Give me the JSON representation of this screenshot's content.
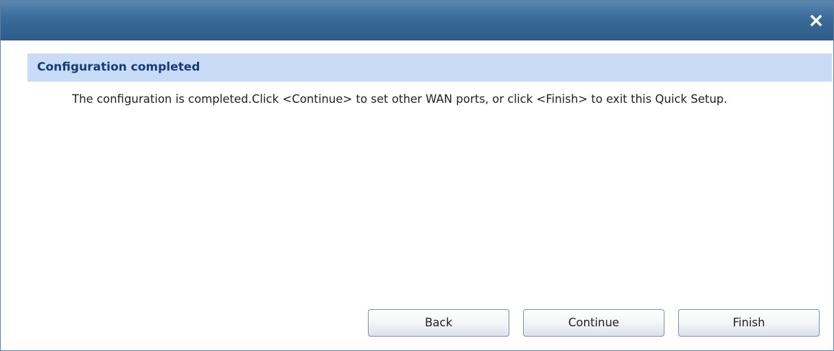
{
  "dialog": {
    "close_icon": "close-icon",
    "section_title": "Configuration completed",
    "message": "The configuration is completed.Click <Continue> to set other WAN ports, or click <Finish> to exit this Quick Setup."
  },
  "buttons": {
    "back_label": "Back",
    "continue_label": "Continue",
    "finish_label": "Finish"
  },
  "colors": {
    "titlebar": "#3a6a99",
    "section_header_bg": "#c9dcf7",
    "section_title_text": "#163c78"
  }
}
